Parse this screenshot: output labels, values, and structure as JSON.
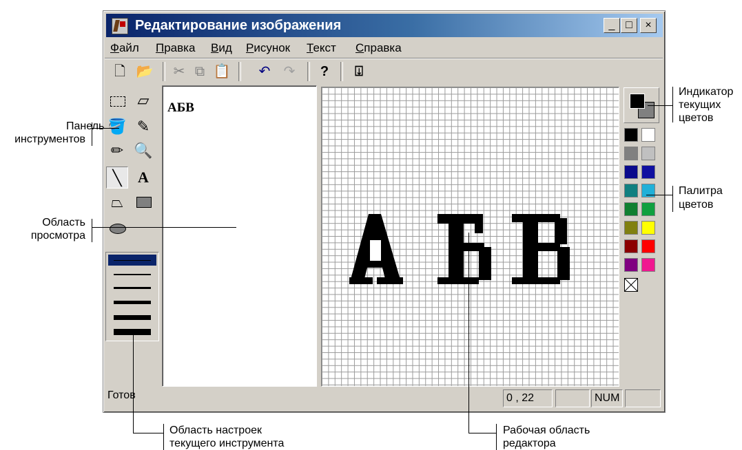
{
  "window": {
    "title": "Редактирование изображения",
    "min": "_",
    "max": "□",
    "close": "×"
  },
  "menu": [
    "Файл",
    "Правка",
    "Вид",
    "Рисунок",
    "Текст",
    "Справка"
  ],
  "toolbar": [
    "new-icon",
    "open-icon",
    "cut-icon",
    "copy-icon",
    "paste-icon",
    "undo-icon",
    "redo-icon",
    "help-icon",
    "context-help-icon"
  ],
  "tools": [
    "select-rect",
    "eraser",
    "fill",
    "eyedropper",
    "pencil",
    "magnifier",
    "line",
    "text",
    "polygon",
    "rectangle",
    "ellipse"
  ],
  "preview": {
    "text": "АБВ"
  },
  "canvas": {
    "text": "АБВ"
  },
  "line_widths": [
    1,
    2,
    3,
    4,
    5
  ],
  "palette": [
    "#000000",
    "#ffffff",
    "#808080",
    "#c0c0c0",
    "#0a0a8c",
    "#1010a0",
    "#108080",
    "#20b0d8",
    "#108030",
    "#10a040",
    "#808010",
    "#ffff00",
    "#8c0000",
    "#ff0000",
    "#800080",
    "#f01890"
  ],
  "status": {
    "ready": "Готов",
    "coords": "0 , 22",
    "num": "NUM"
  },
  "annotations": {
    "tools_panel": [
      "Панель",
      "инструментов"
    ],
    "preview_area": [
      "Область",
      "просмотра"
    ],
    "settings_area": [
      "Область настроек",
      "текущего инструмента"
    ],
    "work_area": [
      "Рабочая область",
      "редактора"
    ],
    "color_indicator": [
      "Индикатор",
      "текущих",
      "цветов"
    ],
    "palette": [
      "Палитра",
      "цветов"
    ]
  }
}
